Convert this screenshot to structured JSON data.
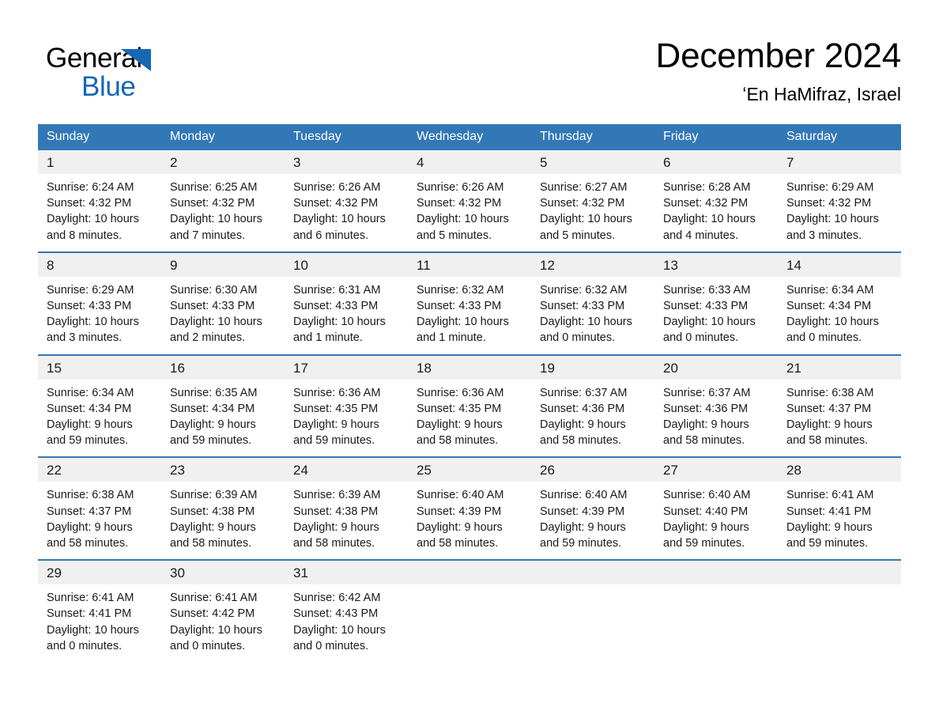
{
  "brand": {
    "logo_general": "General",
    "logo_blue": "Blue",
    "accent_color": "#1668b3",
    "header_color": "#3278b7"
  },
  "header": {
    "title": "December 2024",
    "location": "ʻEn HaMifraz, Israel"
  },
  "calendar": {
    "weekday_headers": [
      "Sunday",
      "Monday",
      "Tuesday",
      "Wednesday",
      "Thursday",
      "Friday",
      "Saturday"
    ],
    "weeks": [
      [
        {
          "day": "1",
          "sunrise": "Sunrise: 6:24 AM",
          "sunset": "Sunset: 4:32 PM",
          "daylight": "Daylight: 10 hours and 8 minutes."
        },
        {
          "day": "2",
          "sunrise": "Sunrise: 6:25 AM",
          "sunset": "Sunset: 4:32 PM",
          "daylight": "Daylight: 10 hours and 7 minutes."
        },
        {
          "day": "3",
          "sunrise": "Sunrise: 6:26 AM",
          "sunset": "Sunset: 4:32 PM",
          "daylight": "Daylight: 10 hours and 6 minutes."
        },
        {
          "day": "4",
          "sunrise": "Sunrise: 6:26 AM",
          "sunset": "Sunset: 4:32 PM",
          "daylight": "Daylight: 10 hours and 5 minutes."
        },
        {
          "day": "5",
          "sunrise": "Sunrise: 6:27 AM",
          "sunset": "Sunset: 4:32 PM",
          "daylight": "Daylight: 10 hours and 5 minutes."
        },
        {
          "day": "6",
          "sunrise": "Sunrise: 6:28 AM",
          "sunset": "Sunset: 4:32 PM",
          "daylight": "Daylight: 10 hours and 4 minutes."
        },
        {
          "day": "7",
          "sunrise": "Sunrise: 6:29 AM",
          "sunset": "Sunset: 4:32 PM",
          "daylight": "Daylight: 10 hours and 3 minutes."
        }
      ],
      [
        {
          "day": "8",
          "sunrise": "Sunrise: 6:29 AM",
          "sunset": "Sunset: 4:33 PM",
          "daylight": "Daylight: 10 hours and 3 minutes."
        },
        {
          "day": "9",
          "sunrise": "Sunrise: 6:30 AM",
          "sunset": "Sunset: 4:33 PM",
          "daylight": "Daylight: 10 hours and 2 minutes."
        },
        {
          "day": "10",
          "sunrise": "Sunrise: 6:31 AM",
          "sunset": "Sunset: 4:33 PM",
          "daylight": "Daylight: 10 hours and 1 minute."
        },
        {
          "day": "11",
          "sunrise": "Sunrise: 6:32 AM",
          "sunset": "Sunset: 4:33 PM",
          "daylight": "Daylight: 10 hours and 1 minute."
        },
        {
          "day": "12",
          "sunrise": "Sunrise: 6:32 AM",
          "sunset": "Sunset: 4:33 PM",
          "daylight": "Daylight: 10 hours and 0 minutes."
        },
        {
          "day": "13",
          "sunrise": "Sunrise: 6:33 AM",
          "sunset": "Sunset: 4:33 PM",
          "daylight": "Daylight: 10 hours and 0 minutes."
        },
        {
          "day": "14",
          "sunrise": "Sunrise: 6:34 AM",
          "sunset": "Sunset: 4:34 PM",
          "daylight": "Daylight: 10 hours and 0 minutes."
        }
      ],
      [
        {
          "day": "15",
          "sunrise": "Sunrise: 6:34 AM",
          "sunset": "Sunset: 4:34 PM",
          "daylight": "Daylight: 9 hours and 59 minutes."
        },
        {
          "day": "16",
          "sunrise": "Sunrise: 6:35 AM",
          "sunset": "Sunset: 4:34 PM",
          "daylight": "Daylight: 9 hours and 59 minutes."
        },
        {
          "day": "17",
          "sunrise": "Sunrise: 6:36 AM",
          "sunset": "Sunset: 4:35 PM",
          "daylight": "Daylight: 9 hours and 59 minutes."
        },
        {
          "day": "18",
          "sunrise": "Sunrise: 6:36 AM",
          "sunset": "Sunset: 4:35 PM",
          "daylight": "Daylight: 9 hours and 58 minutes."
        },
        {
          "day": "19",
          "sunrise": "Sunrise: 6:37 AM",
          "sunset": "Sunset: 4:36 PM",
          "daylight": "Daylight: 9 hours and 58 minutes."
        },
        {
          "day": "20",
          "sunrise": "Sunrise: 6:37 AM",
          "sunset": "Sunset: 4:36 PM",
          "daylight": "Daylight: 9 hours and 58 minutes."
        },
        {
          "day": "21",
          "sunrise": "Sunrise: 6:38 AM",
          "sunset": "Sunset: 4:37 PM",
          "daylight": "Daylight: 9 hours and 58 minutes."
        }
      ],
      [
        {
          "day": "22",
          "sunrise": "Sunrise: 6:38 AM",
          "sunset": "Sunset: 4:37 PM",
          "daylight": "Daylight: 9 hours and 58 minutes."
        },
        {
          "day": "23",
          "sunrise": "Sunrise: 6:39 AM",
          "sunset": "Sunset: 4:38 PM",
          "daylight": "Daylight: 9 hours and 58 minutes."
        },
        {
          "day": "24",
          "sunrise": "Sunrise: 6:39 AM",
          "sunset": "Sunset: 4:38 PM",
          "daylight": "Daylight: 9 hours and 58 minutes."
        },
        {
          "day": "25",
          "sunrise": "Sunrise: 6:40 AM",
          "sunset": "Sunset: 4:39 PM",
          "daylight": "Daylight: 9 hours and 58 minutes."
        },
        {
          "day": "26",
          "sunrise": "Sunrise: 6:40 AM",
          "sunset": "Sunset: 4:39 PM",
          "daylight": "Daylight: 9 hours and 59 minutes."
        },
        {
          "day": "27",
          "sunrise": "Sunrise: 6:40 AM",
          "sunset": "Sunset: 4:40 PM",
          "daylight": "Daylight: 9 hours and 59 minutes."
        },
        {
          "day": "28",
          "sunrise": "Sunrise: 6:41 AM",
          "sunset": "Sunset: 4:41 PM",
          "daylight": "Daylight: 9 hours and 59 minutes."
        }
      ],
      [
        {
          "day": "29",
          "sunrise": "Sunrise: 6:41 AM",
          "sunset": "Sunset: 4:41 PM",
          "daylight": "Daylight: 10 hours and 0 minutes."
        },
        {
          "day": "30",
          "sunrise": "Sunrise: 6:41 AM",
          "sunset": "Sunset: 4:42 PM",
          "daylight": "Daylight: 10 hours and 0 minutes."
        },
        {
          "day": "31",
          "sunrise": "Sunrise: 6:42 AM",
          "sunset": "Sunset: 4:43 PM",
          "daylight": "Daylight: 10 hours and 0 minutes."
        },
        {
          "day": "",
          "sunrise": "",
          "sunset": "",
          "daylight": ""
        },
        {
          "day": "",
          "sunrise": "",
          "sunset": "",
          "daylight": ""
        },
        {
          "day": "",
          "sunrise": "",
          "sunset": "",
          "daylight": ""
        },
        {
          "day": "",
          "sunrise": "",
          "sunset": "",
          "daylight": ""
        }
      ]
    ]
  }
}
